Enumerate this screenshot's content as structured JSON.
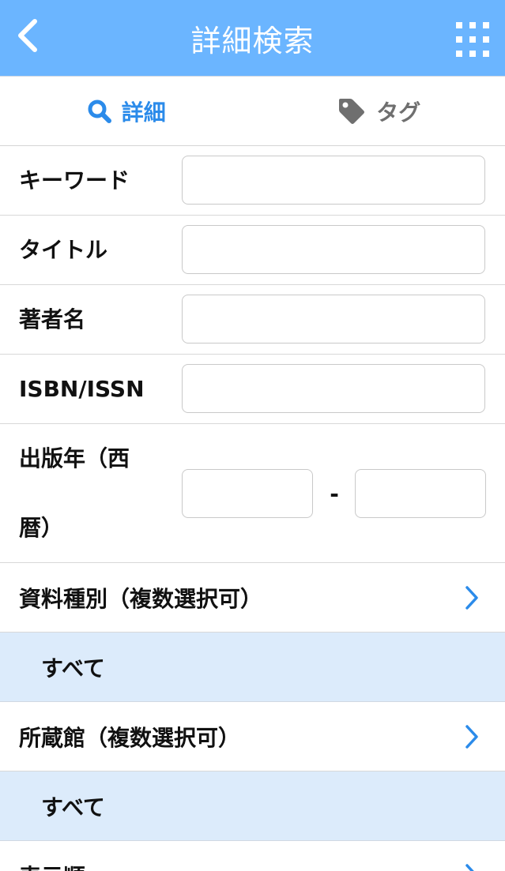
{
  "header": {
    "title": "詳細検索",
    "back_icon": "chevron-left-icon",
    "menu_icon": "grid-menu-icon"
  },
  "tabs": [
    {
      "label": "詳細",
      "icon": "search-icon",
      "active": true
    },
    {
      "label": "タグ",
      "icon": "tag-icon",
      "active": false
    }
  ],
  "fields": {
    "keyword": {
      "label": "キーワード",
      "value": "",
      "placeholder": ""
    },
    "title": {
      "label": "タイトル",
      "value": "",
      "placeholder": ""
    },
    "author": {
      "label": "著者名",
      "value": "",
      "placeholder": ""
    },
    "isbn": {
      "label": "ISBN/ISSN",
      "value": "",
      "placeholder": ""
    },
    "year": {
      "label_line1": "出版年（西",
      "label_line2": "暦）",
      "from_value": "",
      "separator": "-",
      "to_value": ""
    }
  },
  "material_type": {
    "label": "資料種別（複数選択可）",
    "selected": "すべて"
  },
  "library": {
    "label": "所蔵館（複数選択可）",
    "selected": "すべて"
  },
  "sort_order": {
    "label": "表示順"
  },
  "colors": {
    "header_bg": "#6bb5ff",
    "accent": "#2b8bea",
    "selected_bg": "#dcebfb"
  }
}
